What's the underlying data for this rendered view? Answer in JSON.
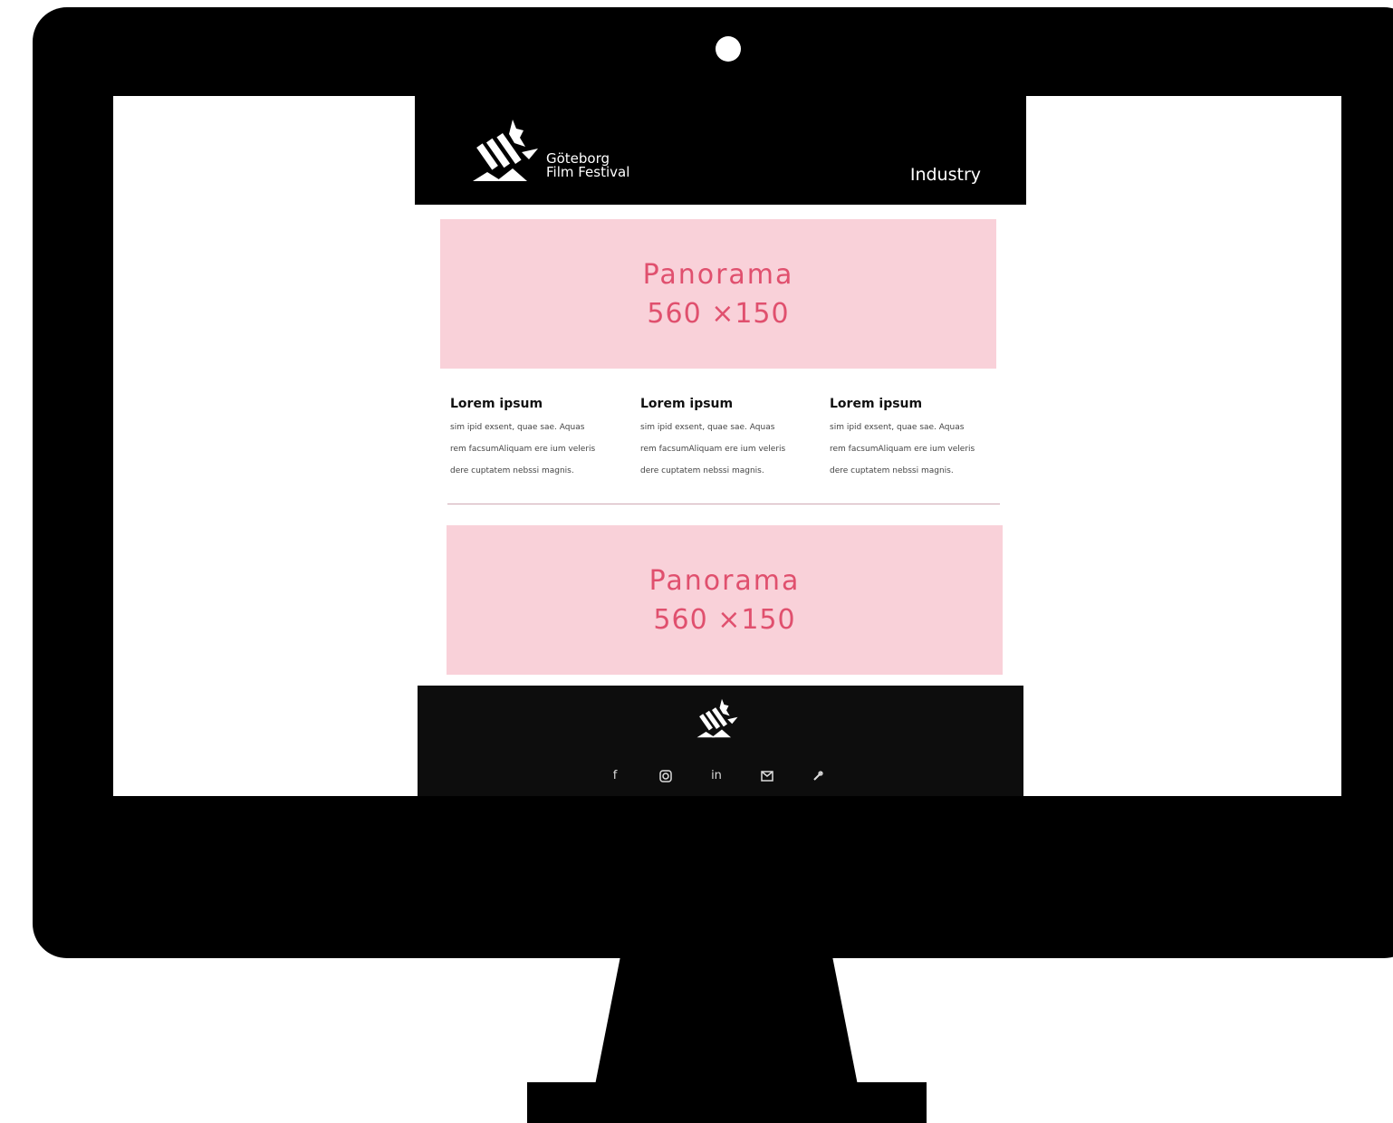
{
  "header": {
    "brand_line1": "Göteborg",
    "brand_line2": "Film Festival",
    "nav_link": "Industry"
  },
  "banners": [
    {
      "title": "Panorama",
      "size": "560 ×150"
    },
    {
      "title": "Panorama",
      "size": "560 ×150"
    }
  ],
  "columns": [
    {
      "title": "Lorem ipsum",
      "line1": "sim ipid exsent, quae sae. Aquas",
      "line2": "rem facsumAliquam ere ium veleris",
      "line3": "dere cuptatem nebssi magnis."
    },
    {
      "title": "Lorem ipsum",
      "line1": "sim ipid exsent, quae sae. Aquas",
      "line2": "rem facsumAliquam ere ium veleris",
      "line3": "dere cuptatem nebssi magnis."
    },
    {
      "title": "Lorem ipsum",
      "line1": "sim ipid exsent, quae sae. Aquas",
      "line2": "rem facsumAliquam ere ium veleris",
      "line3": "dere cuptatem nebssi magnis."
    }
  ],
  "footer": {
    "social_icons": [
      "facebook-icon",
      "instagram-icon",
      "linkedin-icon",
      "mail-icon",
      "link-icon"
    ]
  },
  "colors": {
    "banner_bg": "#f9d1d9",
    "banner_text": "#e0506e",
    "header_bg": "#000000"
  }
}
